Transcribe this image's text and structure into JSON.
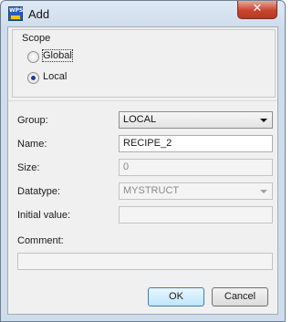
{
  "window": {
    "title": "Add",
    "close_symbol": "✕",
    "app_icon_text": "WPS"
  },
  "scope": {
    "label": "Scope",
    "options": [
      {
        "label": "Global",
        "checked": false
      },
      {
        "label": "Local",
        "checked": true
      }
    ]
  },
  "form": {
    "group": {
      "label": "Group:",
      "value": "LOCAL"
    },
    "name": {
      "label": "Name:",
      "value": "RECIPE_2"
    },
    "size": {
      "label": "Size:",
      "value": "0"
    },
    "datatype": {
      "label": "Datatype:",
      "value": "MYSTRUCT"
    },
    "initial_value": {
      "label": "Initial value:",
      "value": ""
    },
    "comment": {
      "label": "Comment:",
      "value": ""
    }
  },
  "buttons": {
    "ok": "OK",
    "cancel": "Cancel"
  }
}
